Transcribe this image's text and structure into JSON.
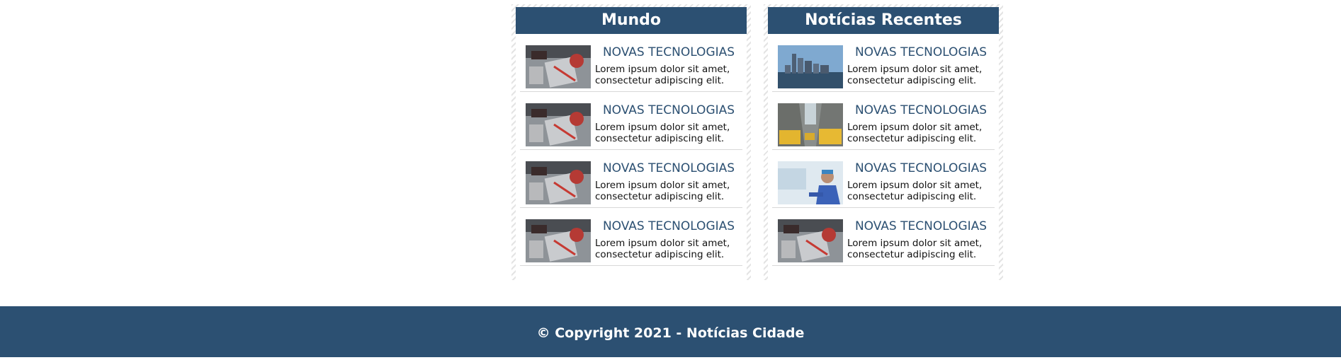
{
  "columns": {
    "left": {
      "title": "Mundo",
      "items": [
        {
          "title": "NOVAS TECNOLOGIAS",
          "text": "Lorem ipsum dolor sit amet, consectetur adipiscing elit.",
          "image": "desk-notebook-image"
        },
        {
          "title": "NOVAS TECNOLOGIAS",
          "text": "Lorem ipsum dolor sit amet, consectetur adipiscing elit.",
          "image": "desk-notebook-image"
        },
        {
          "title": "NOVAS TECNOLOGIAS",
          "text": "Lorem ipsum dolor sit amet, consectetur adipiscing elit.",
          "image": "desk-notebook-image"
        },
        {
          "title": "NOVAS TECNOLOGIAS",
          "text": "Lorem ipsum dolor sit amet, consectetur adipiscing elit.",
          "image": "desk-notebook-image"
        }
      ]
    },
    "right": {
      "title": "Notícias Recentes",
      "items": [
        {
          "title": "NOVAS TECNOLOGIAS",
          "text": "Lorem ipsum dolor sit amet, consectetur adipiscing elit.",
          "image": "city-skyline-image"
        },
        {
          "title": "NOVAS TECNOLOGIAS",
          "text": "Lorem ipsum dolor sit amet, consectetur adipiscing elit.",
          "image": "city-taxi-street-image"
        },
        {
          "title": "NOVAS TECNOLOGIAS",
          "text": "Lorem ipsum dolor sit amet, consectetur adipiscing elit.",
          "image": "doctor-image"
        },
        {
          "title": "NOVAS TECNOLOGIAS",
          "text": "Lorem ipsum dolor sit amet, consectetur adipiscing elit.",
          "image": "desk-notebook-image"
        }
      ]
    }
  },
  "footer": {
    "copyright": "© Copyright 2021 - Notícias Cidade"
  },
  "colors": {
    "brand": "#2c5072",
    "background": "#ffffff"
  }
}
